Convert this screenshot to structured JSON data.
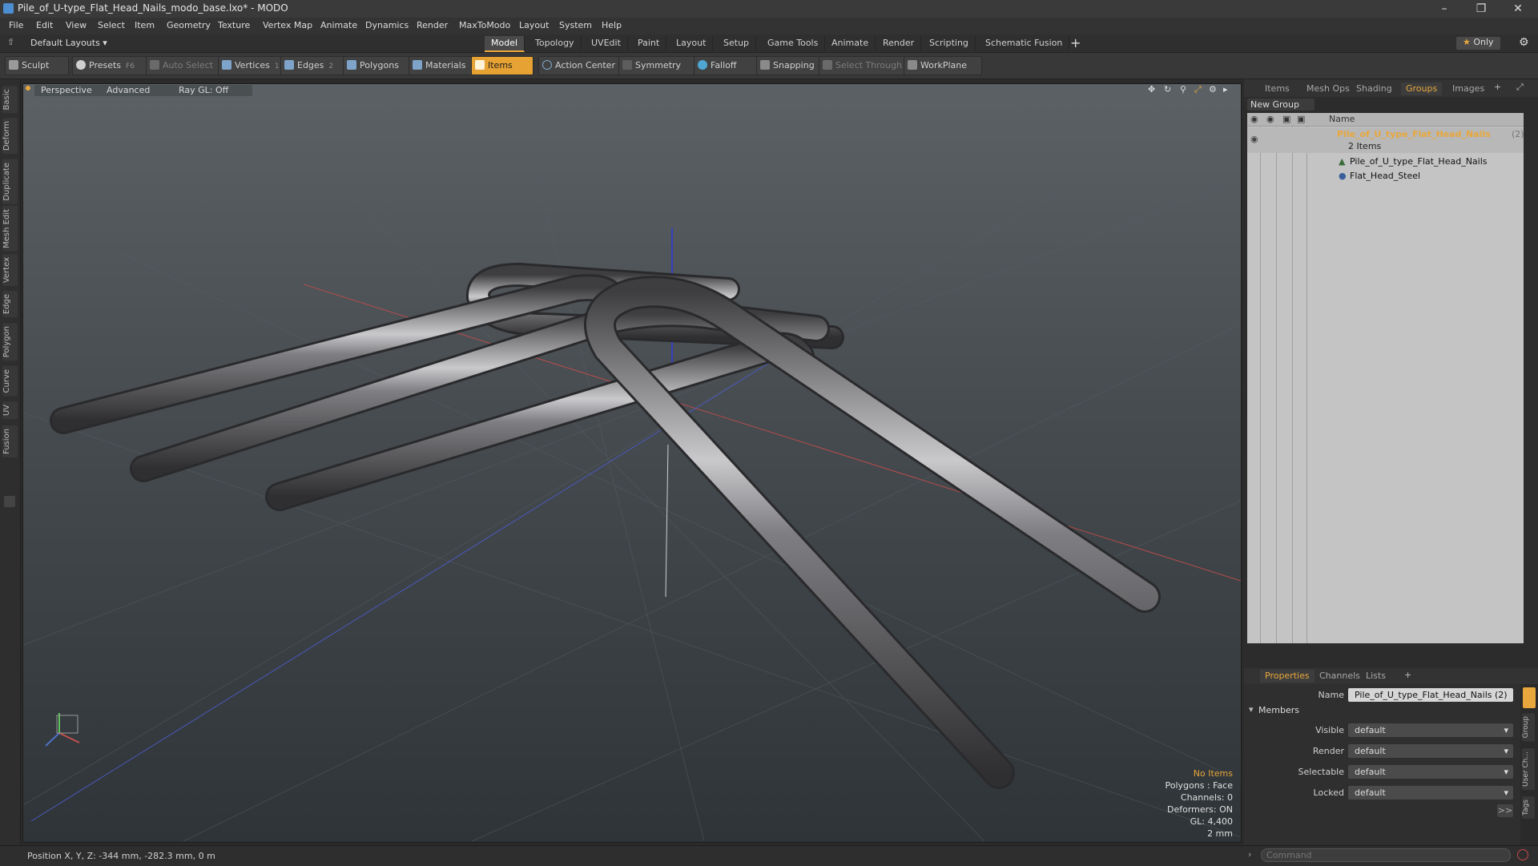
{
  "window": {
    "title": "Pile_of_U-type_Flat_Head_Nails_modo_base.lxo* - MODO"
  },
  "menu": [
    "File",
    "Edit",
    "View",
    "Select",
    "Item",
    "Geometry",
    "Texture",
    "Vertex Map",
    "Animate",
    "Dynamics",
    "Render",
    "MaxToModo",
    "Layout",
    "System",
    "Help"
  ],
  "layouts": {
    "selector": "Default Layouts ▾",
    "tabs": [
      "Model",
      "Topology",
      "UVEdit",
      "Paint",
      "Layout",
      "Setup",
      "Game Tools",
      "Animate",
      "Render",
      "Scripting",
      "Schematic Fusion"
    ],
    "active": "Model",
    "only_label": "Only"
  },
  "toolbar": {
    "sculpt": "Sculpt",
    "presets": "Presets",
    "presets_key": "F6",
    "auto_select": "Auto Select",
    "vertices": "Vertices",
    "vertices_count": "1",
    "edges": "Edges",
    "edges_count": "2",
    "polygons": "Polygons",
    "materials": "Materials",
    "items": "Items",
    "action_center": "Action Center",
    "symmetry": "Symmetry",
    "falloff": "Falloff",
    "snapping": "Snapping",
    "select_through": "Select Through",
    "workplane": "WorkPlane"
  },
  "left_tabs": [
    "Basic",
    "Deform",
    "Duplicate",
    "Mesh Edit",
    "Vertex",
    "Edge",
    "Polygon",
    "Curve",
    "UV",
    "Fusion"
  ],
  "viewport": {
    "view": "Perspective",
    "shading": "Advanced",
    "raygl": "Ray GL: Off",
    "info": {
      "no_items": "No Items",
      "polygons": "Polygons : Face",
      "channels": "Channels: 0",
      "deformers": "Deformers: ON",
      "gl": "GL: 4,400",
      "size": "2 mm"
    }
  },
  "right_panel": {
    "tabs": [
      "Items",
      "Mesh Ops",
      "Shading",
      "Groups",
      "Images"
    ],
    "active_tab": "Groups",
    "new_group": "New Group",
    "col_name": "Name",
    "group": {
      "name": "Pile_of_U_type_Flat_Head_Nails",
      "count": "(2)",
      "subtitle": "2 Items",
      "children": [
        "Pile_of_U_type_Flat_Head_Nails",
        "Flat_Head_Steel"
      ]
    }
  },
  "properties": {
    "tabs": [
      "Properties",
      "Channels",
      "Lists"
    ],
    "active_tab": "Properties",
    "name_label": "Name",
    "name_value": "Pile_of_U_type_Flat_Head_Nails (2)",
    "members_label": "Members",
    "rows": [
      {
        "label": "Visible",
        "value": "default"
      },
      {
        "label": "Render",
        "value": "default"
      },
      {
        "label": "Selectable",
        "value": "default"
      },
      {
        "label": "Locked",
        "value": "default"
      }
    ],
    "side_tabs": [
      "Group",
      "User Ch...",
      "Tags"
    ],
    "more": ">>"
  },
  "status": {
    "position": "Position X, Y, Z:  -344 mm, -282.3 mm, 0 m",
    "command_placeholder": "Command"
  },
  "colors": {
    "accent": "#e8a73c",
    "viewport_top": "#5b6165",
    "viewport_bottom": "#2e3437"
  }
}
